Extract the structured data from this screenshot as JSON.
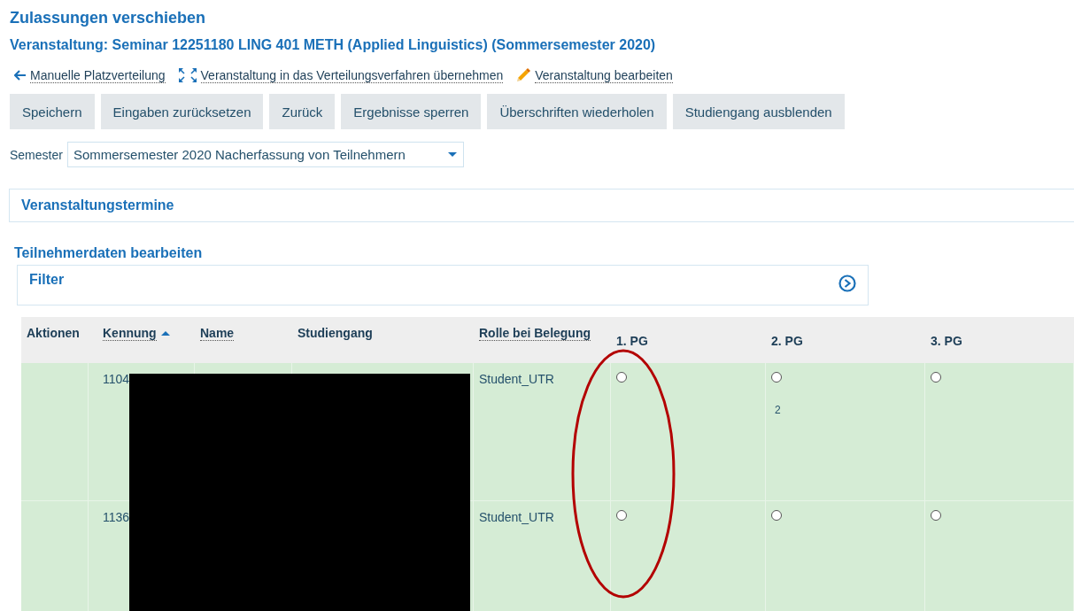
{
  "title": "Zulassungen verschieben",
  "subtitle": "Veranstaltung: Seminar 12251180 LING 401 METH (Applied Linguistics) (Sommersemester 2020)",
  "links": [
    {
      "kind": "back",
      "label": "Manuelle Platzverteilung"
    },
    {
      "kind": "expand",
      "label": "Veranstaltung in das Verteilungsverfahren übernehmen"
    },
    {
      "kind": "edit",
      "label": "Veranstaltung bearbeiten"
    }
  ],
  "buttons": [
    "Speichern",
    "Eingaben zurücksetzen",
    "Zurück",
    "Ergebnisse sperren",
    "Überschriften wiederholen",
    "Studiengang ausblenden"
  ],
  "semester": {
    "label": "Semester",
    "value": "Sommersemester 2020 Nacherfassung von Teilnehmern"
  },
  "appointments_panel": "Veranstaltungstermine",
  "section_title": "Teilnehmerdaten bearbeiten",
  "filter_panel": "Filter",
  "table": {
    "columns": [
      {
        "label": "Aktionen",
        "sortable": false,
        "sorted": false
      },
      {
        "label": "Kennung",
        "sortable": true,
        "sorted": true
      },
      {
        "label": "Name",
        "sortable": true,
        "sorted": false
      },
      {
        "label": "Studiengang",
        "sortable": false,
        "sorted": false
      },
      {
        "label": "Rolle bei Belegung",
        "sortable": true,
        "sorted": false
      },
      {
        "label": "1. PG",
        "sortable": false,
        "sorted": false
      },
      {
        "label": "2. PG",
        "sortable": false,
        "sorted": false
      },
      {
        "label": "3. PG",
        "sortable": false,
        "sorted": false
      }
    ],
    "rows": [
      {
        "kennung": "1104",
        "rolle": "Student_UTR",
        "pg": [
          {
            "selected": false
          },
          {
            "selected": false,
            "note": "2"
          },
          {
            "selected": false
          }
        ]
      },
      {
        "kennung": "1136",
        "rolle": "Student_UTR",
        "pg": [
          {
            "selected": false
          },
          {
            "selected": false
          },
          {
            "selected": false
          }
        ]
      }
    ]
  }
}
